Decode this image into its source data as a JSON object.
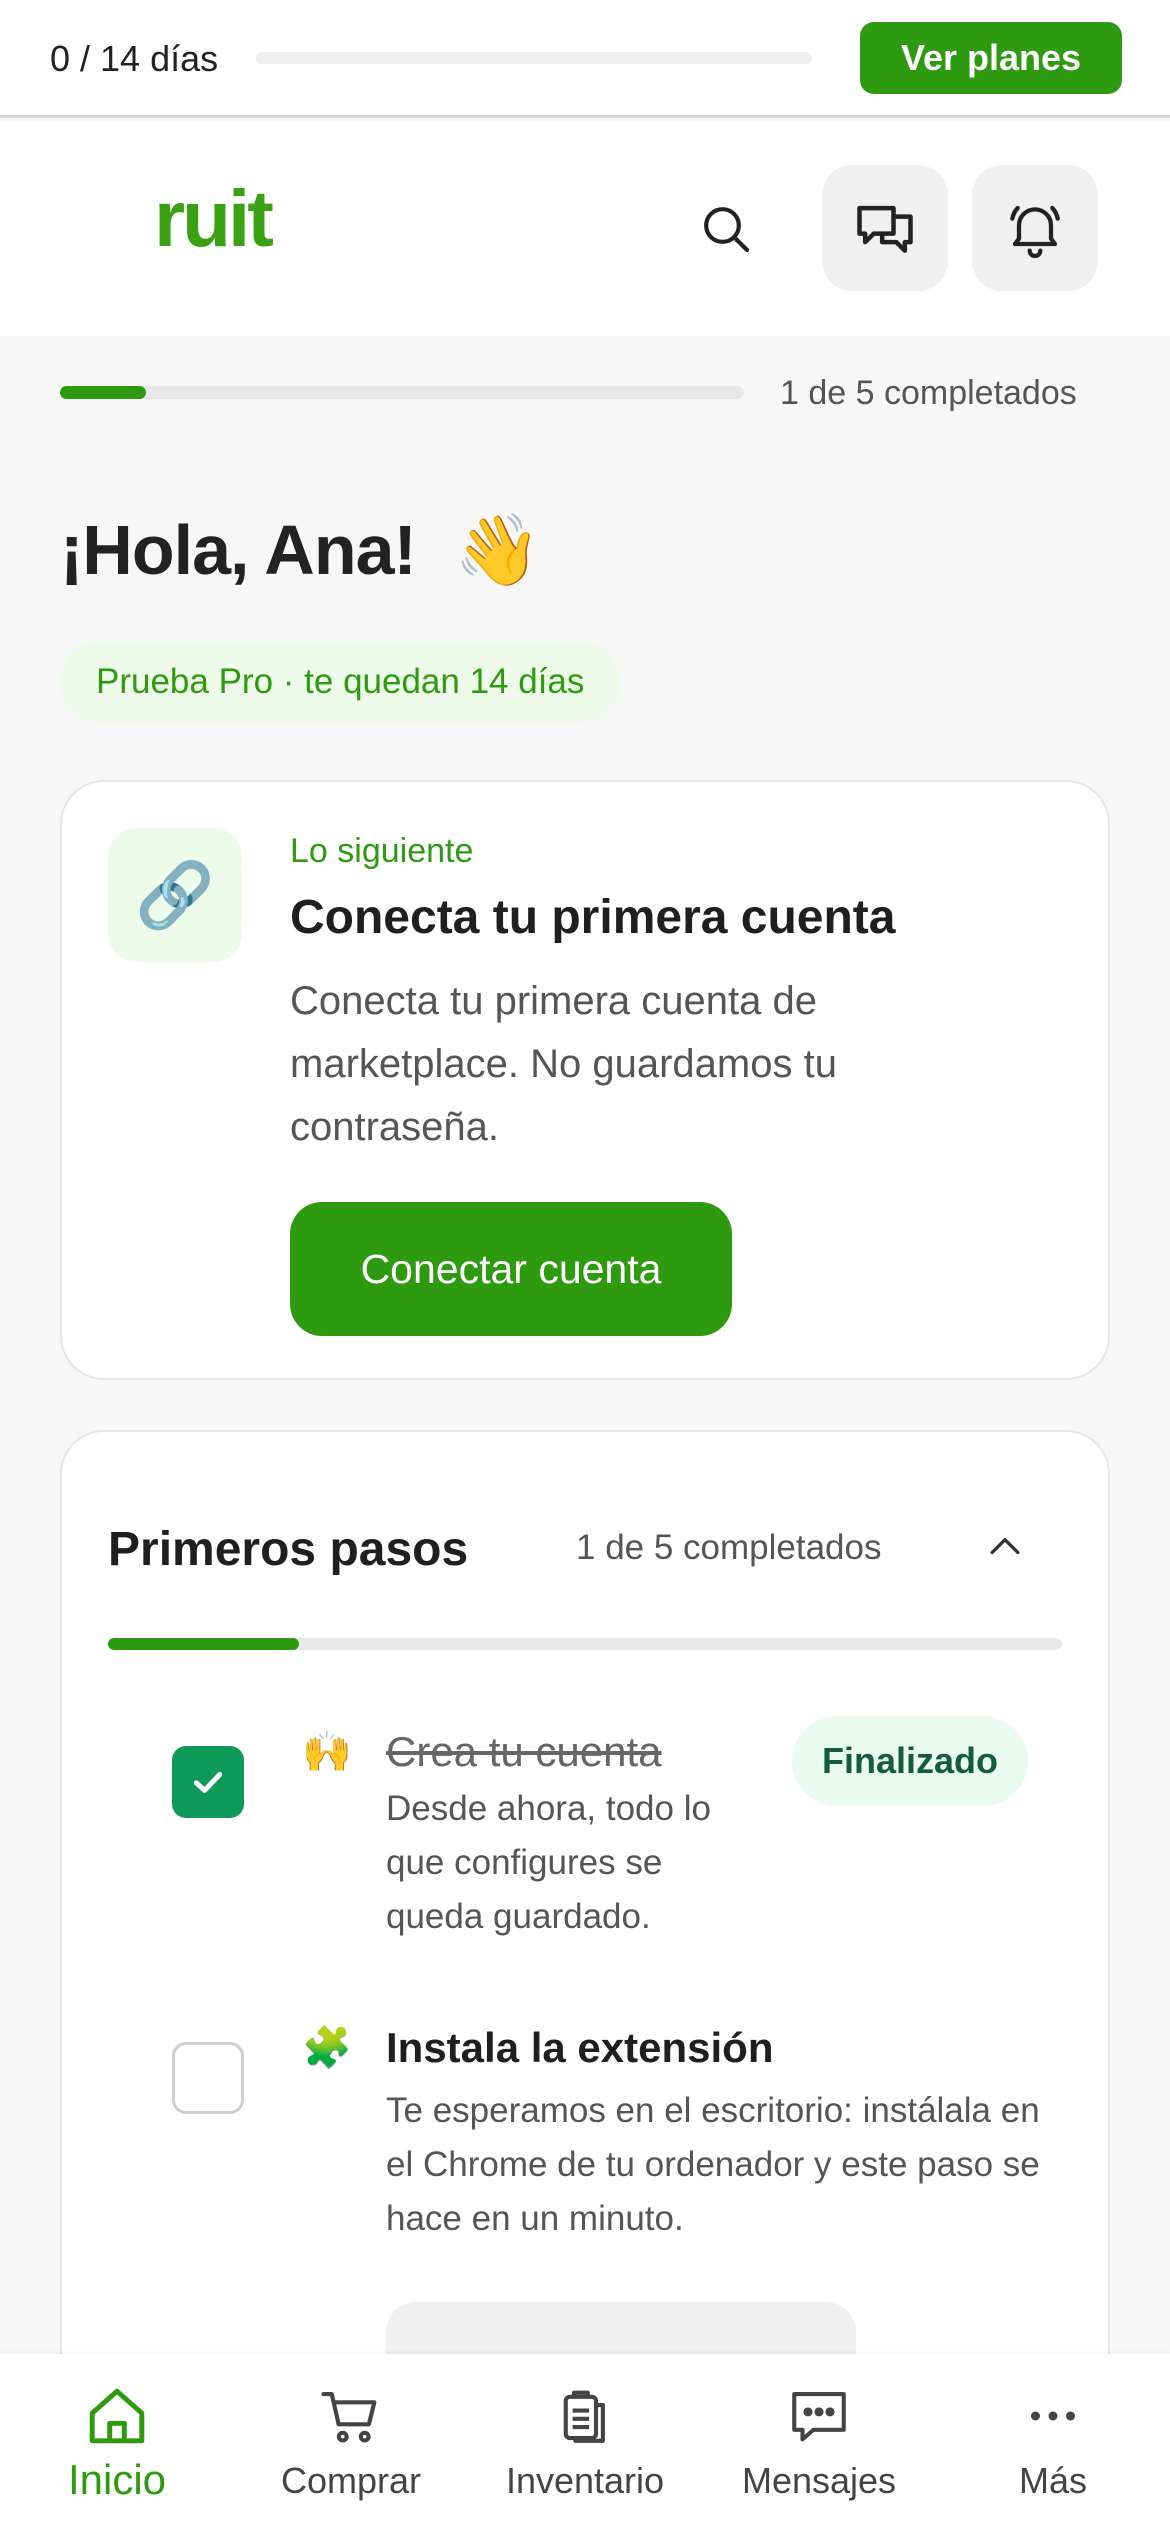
{
  "trial_bar": {
    "days_text": "0 / 14 días",
    "progress_fraction": 0,
    "cta_label": "Ver planes"
  },
  "header": {
    "logo_text": "ruit",
    "icons": [
      "search-icon",
      "chat-icon",
      "bell-icon"
    ]
  },
  "onboarding": {
    "progress_fraction": 0.2,
    "progress_text": "1 de 5 completados"
  },
  "greeting": {
    "text": "¡Hola, Ana!",
    "emoji": "👋"
  },
  "trial_pill": "Prueba Pro · te quedan 14 días",
  "next_card": {
    "icon": "🔗",
    "eyebrow": "Lo siguiente",
    "title": "Conecta tu primera cuenta",
    "description": "Conecta tu primera cuenta de marketplace. No guardamos tu contraseña.",
    "button_label": "Conectar cuenta"
  },
  "steps": {
    "title": "Primeros pasos",
    "count_text": "1 de 5 completados",
    "progress_fraction": 0.2,
    "items": [
      {
        "emoji": "🙌",
        "title": "Crea tu cuenta",
        "description": "Desde ahora, todo lo que configures se queda guardado.",
        "done": true,
        "badge": "Finalizado"
      },
      {
        "emoji": "🧩",
        "title": "Instala la extensión",
        "description": "Te esperamos en el escritorio: instálala en el Chrome de tu ordenador y este paso se hace en un minuto.",
        "done": false
      }
    ]
  },
  "bottom_nav": [
    {
      "label": "Inicio",
      "icon": "home-icon",
      "active": true
    },
    {
      "label": "Comprar",
      "icon": "cart-icon",
      "active": false
    },
    {
      "label": "Inventario",
      "icon": "clipboard-icon",
      "active": false
    },
    {
      "label": "Mensajes",
      "icon": "message-icon",
      "active": false
    },
    {
      "label": "Más",
      "icon": "more-icon",
      "active": false
    }
  ],
  "colors": {
    "brand_green": "#2e9a0f",
    "check_green": "#0f9a5a"
  }
}
